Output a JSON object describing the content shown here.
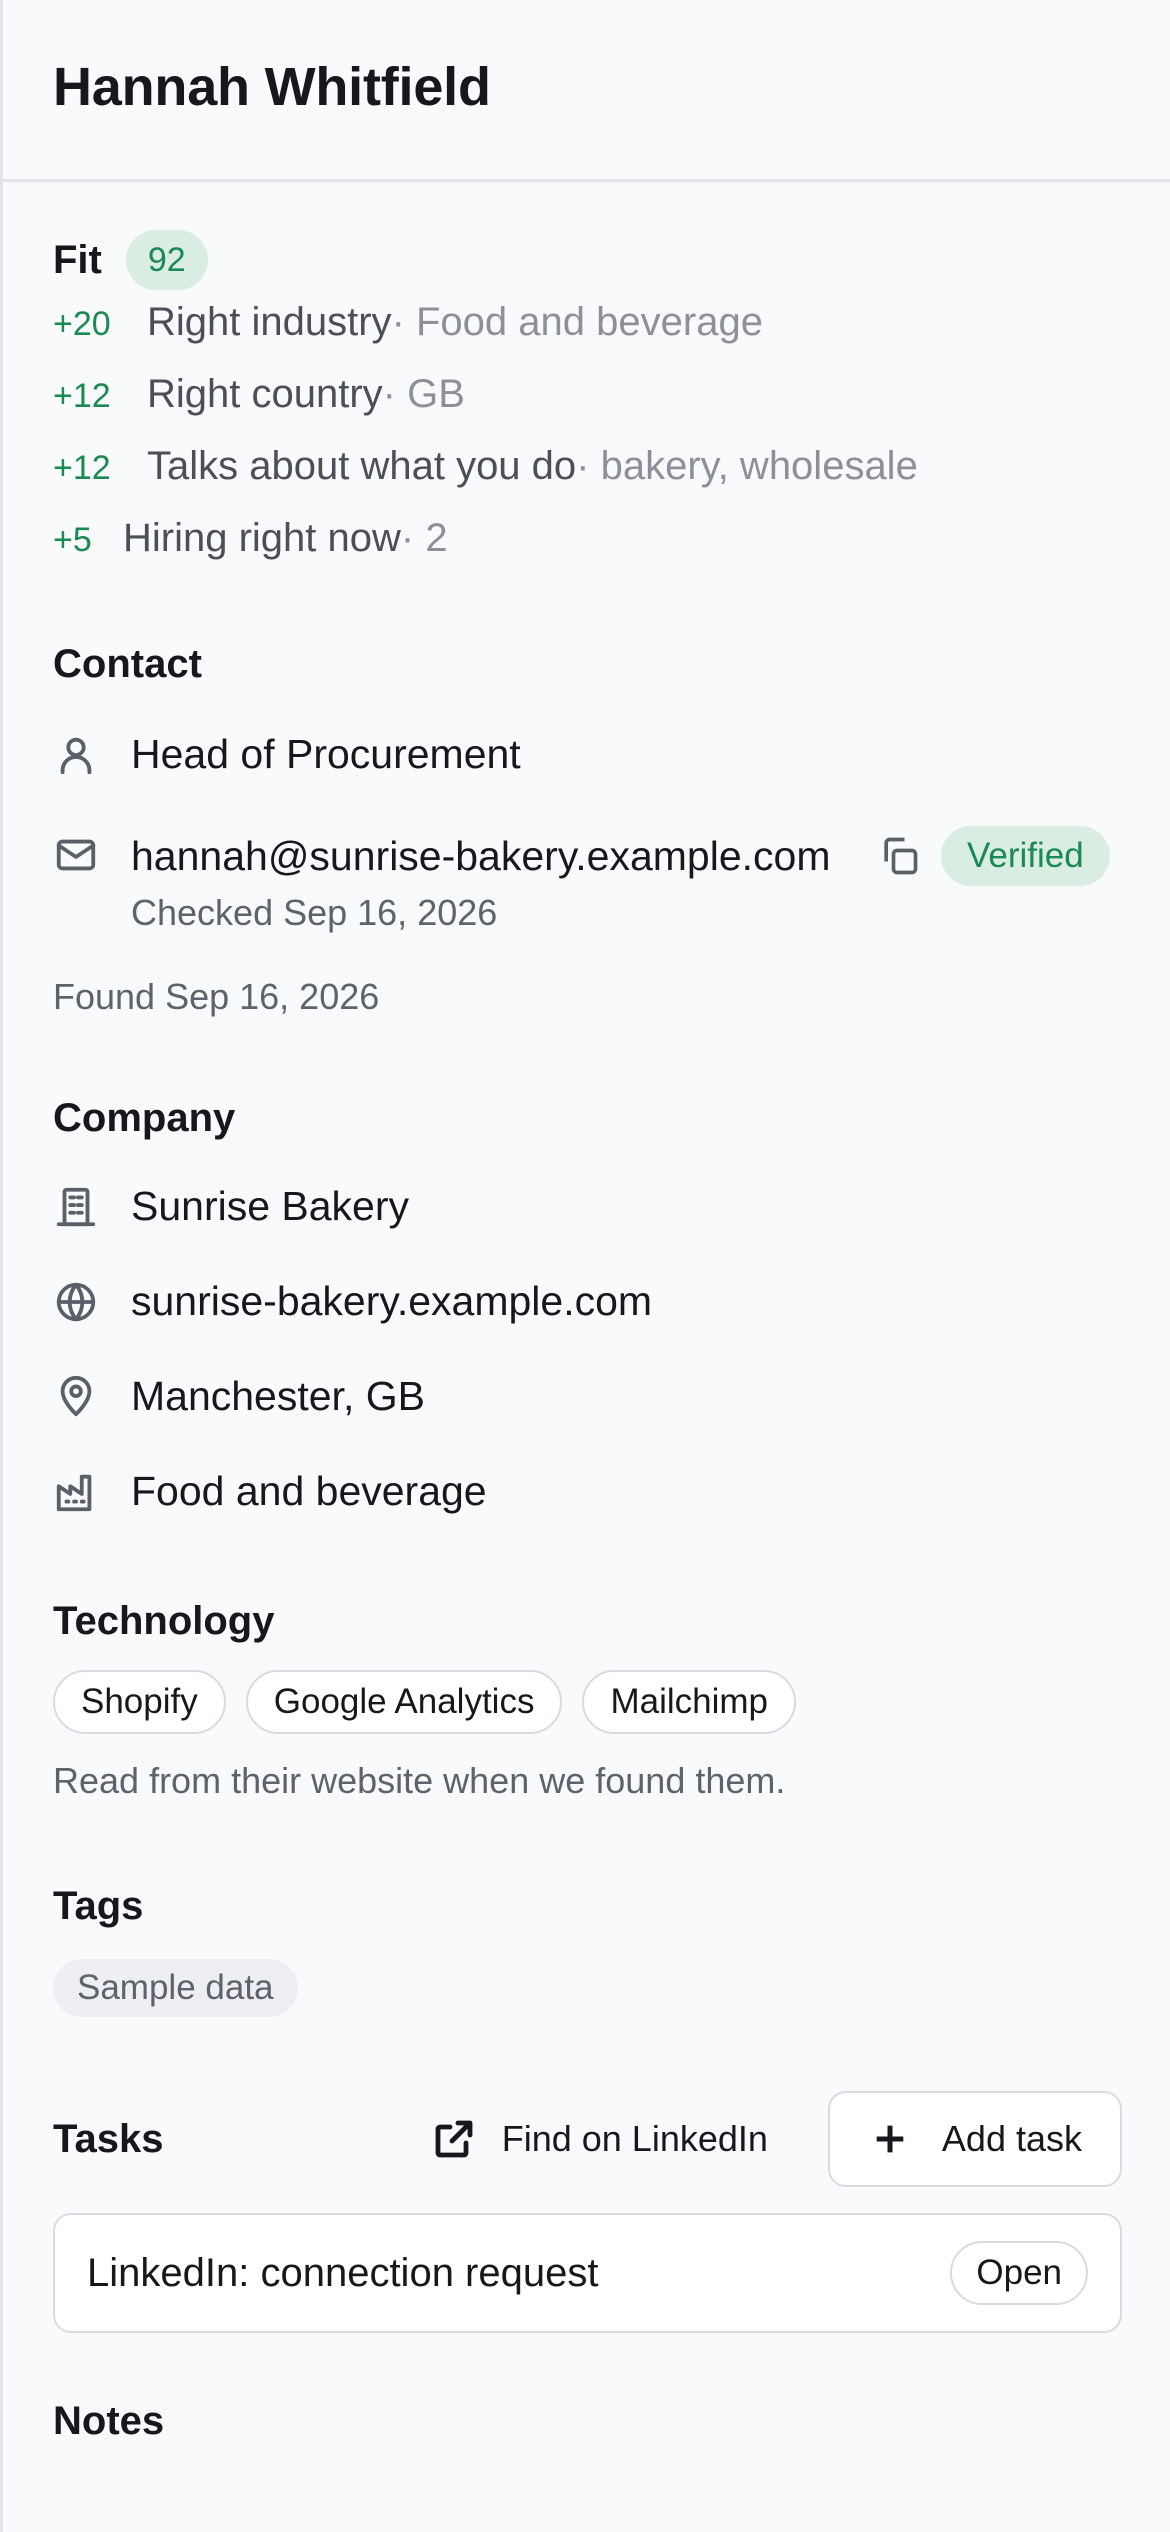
{
  "header": {
    "title": "Hannah Whitfield"
  },
  "fit": {
    "title": "Fit",
    "score": "92",
    "rows": [
      {
        "points": "+20",
        "label": "Right industry",
        "detail": "Food and beverage"
      },
      {
        "points": "+12",
        "label": "Right country",
        "detail": "GB"
      },
      {
        "points": "+12",
        "label": "Talks about what you do",
        "detail": "bakery, wholesale"
      },
      {
        "points": "+5",
        "label": "Hiring right now",
        "detail": "2"
      }
    ]
  },
  "contact": {
    "title": "Contact",
    "job_title": "Head of Procurement",
    "email": "hannah@sunrise-bakery.example.com",
    "email_status": "Verified",
    "checked": "Checked Sep 16, 2026",
    "found": "Found Sep 16, 2026",
    "icons": {
      "person": "person-icon",
      "mail": "mail-icon",
      "copy": "copy-icon"
    }
  },
  "company": {
    "title": "Company",
    "name": "Sunrise Bakery",
    "website": "sunrise-bakery.example.com",
    "location": "Manchester, GB",
    "industry": "Food and beverage"
  },
  "technology": {
    "title": "Technology",
    "items": [
      "Shopify",
      "Google Analytics",
      "Mailchimp"
    ],
    "note": "Read from their website when we found them."
  },
  "tags": {
    "title": "Tags",
    "items": [
      "Sample data"
    ]
  },
  "tasks": {
    "title": "Tasks",
    "linkedin_label": "Find on LinkedIn",
    "add_label": "Add task",
    "items": [
      {
        "label": "LinkedIn: connection request",
        "status": "Open"
      }
    ]
  },
  "notes": {
    "title": "Notes"
  },
  "colors": {
    "accent_green": "#1a8a52",
    "badge_bg": "#d9ede3",
    "background": "#f9fafc"
  }
}
